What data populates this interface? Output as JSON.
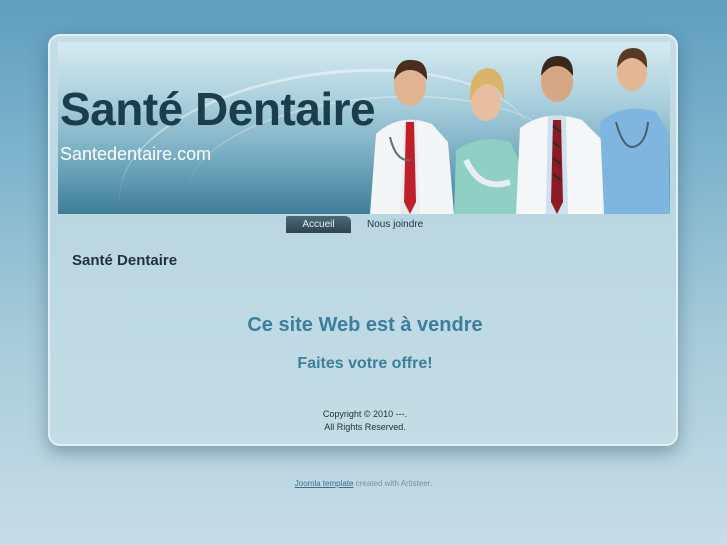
{
  "header": {
    "title": "Santé Dentaire",
    "slogan": "Santedentaire.com"
  },
  "menu": {
    "items": [
      {
        "label": "Accueil",
        "active": true
      },
      {
        "label": "Nous joindre",
        "active": false
      }
    ]
  },
  "content": {
    "heading": "Santé Dentaire",
    "sale_line_1": "Ce site Web est à vendre",
    "sale_line_2": "Faites votre offre!"
  },
  "copyright": {
    "line_1": "Copyright © 2010 ---.",
    "line_2": "All Rights Reserved."
  },
  "footer": {
    "link_label": "Joomla template",
    "suffix": " created with Artisteer."
  },
  "colors": {
    "accent": "#3a7f9c",
    "title": "#1c3d4c",
    "menu_active": "#2d4452"
  }
}
